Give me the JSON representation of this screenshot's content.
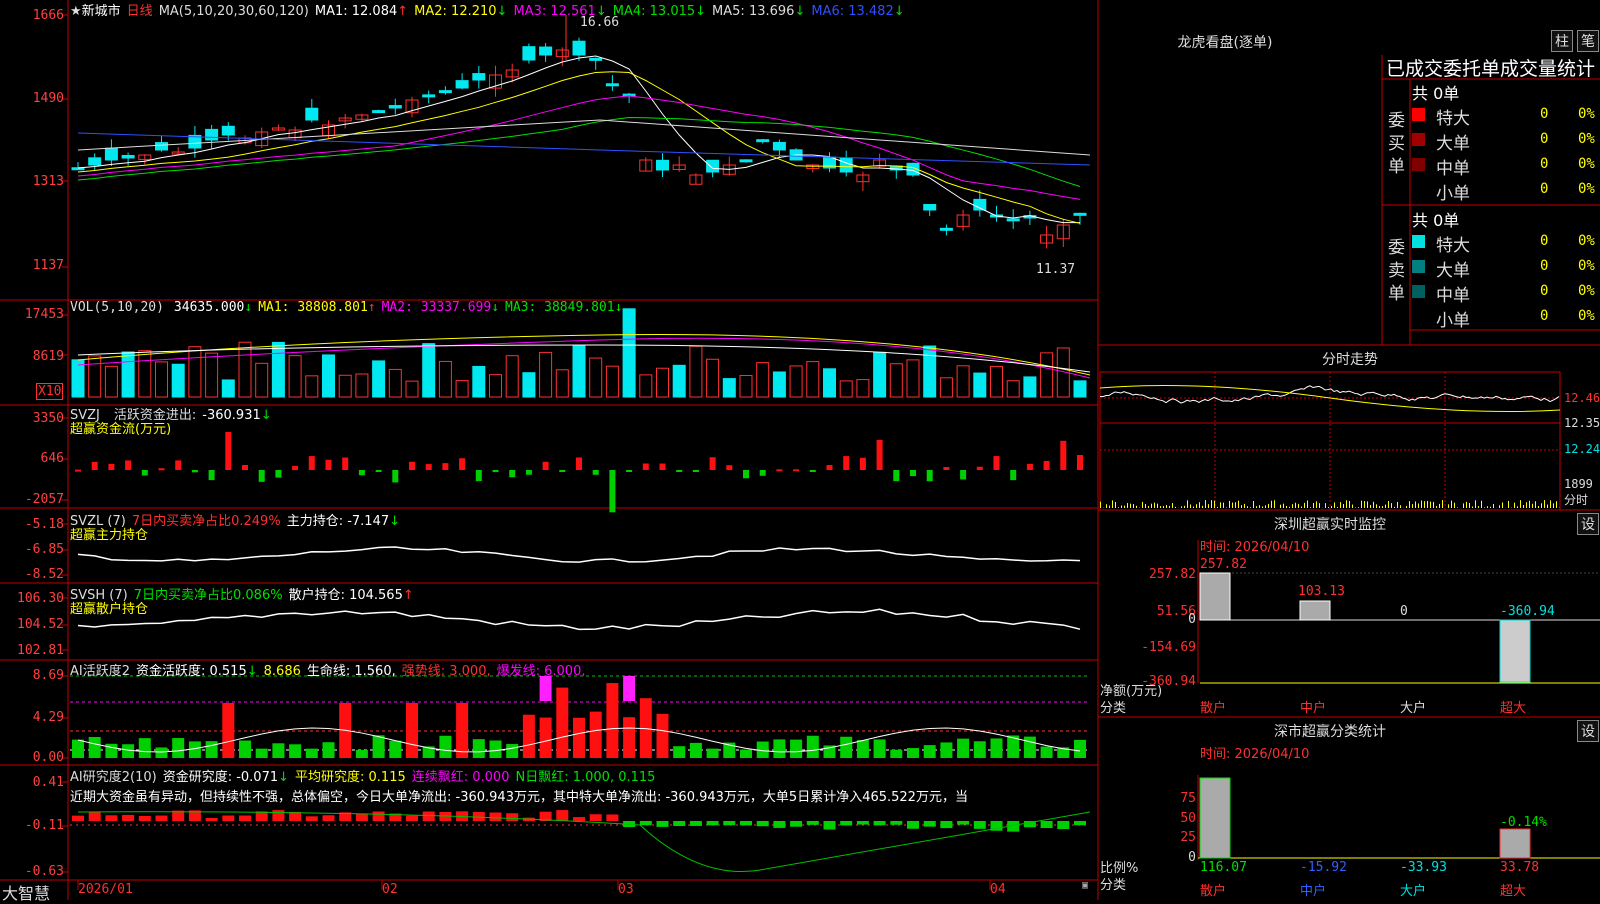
{
  "stock": {
    "star": "★",
    "name": "新城市",
    "period": "日线"
  },
  "main": {
    "ma_header": "MA(5,10,20,30,60,120)",
    "ma1": "MA1: 12.084",
    "ma2": "MA2: 12.210",
    "ma3": "MA3: 12.561",
    "ma4": "MA4: 13.015",
    "ma5": "MA5: 13.696",
    "ma6": "MA6: 13.482",
    "y_labels": [
      "1666",
      "1490",
      "1313",
      "1137"
    ],
    "high_label": "16.66",
    "low_label": "11.37",
    "up_arrow": "↑",
    "down_arrow": "↓"
  },
  "vol": {
    "header": "VOL(5,10,20)",
    "value": "34635.000",
    "ma1": "MA1: 38808.801",
    "ma2": "MA2: 33337.699",
    "ma3": "MA3: 38849.801",
    "y_labels": [
      "17453",
      "8619"
    ],
    "unit": "X10"
  },
  "svzj": {
    "header": "SVZJ",
    "label": "活跃资金进出:",
    "value": "-360.931",
    "subtitle": "超赢资金流(万元)",
    "y_labels": [
      "3350",
      "646",
      "-2057"
    ]
  },
  "svzl": {
    "header": "SVZL (7)",
    "label": "7日内买卖净占比0.249%",
    "hold": "主力持仓: -7.147",
    "subtitle": "超赢主力持仓",
    "y_labels": [
      "-5.18",
      "-6.85",
      "-8.52"
    ]
  },
  "svsh": {
    "header": "SVSH (7)",
    "label": "7日内买卖净占比0.086%",
    "hold": "散户持仓: 104.565",
    "subtitle": "超赢散户持仓",
    "y_labels": [
      "106.30",
      "104.52",
      "102.81"
    ]
  },
  "ai1": {
    "header": "AI活跃度2",
    "label": "资金活跃度: 0.515",
    "val2": "8.686",
    "life": "生命线: 1.560,",
    "strong": "强势线: 3.000,",
    "burst": "爆发线: 6.000,",
    "y_labels": [
      "8.69",
      "4.29",
      "0.00"
    ]
  },
  "ai2": {
    "header": "AI研究度2(10)",
    "label": "资金研究度: -0.071",
    "avg": "平均研究度: 0.115",
    "cont": "连续飘红: 0.000",
    "nday": "N日飘红: 1.000, 0.115",
    "y_labels": [
      "0.41",
      "-0.11",
      "-0.63"
    ],
    "desc": "近期大资金虽有异动，但持续性不强，总体偏空，今日大单净流出: -360.943万元，其中特大单净流出: -360.943万元，大单5日累计净入465.522万元，当"
  },
  "xaxis": {
    "brand": "大智慧",
    "labels": [
      "2026/01",
      "02",
      "03",
      "04"
    ]
  },
  "right": {
    "lhb_title": "龙虎看盘(逐单)",
    "btn_bar": "柱",
    "btn_pen": "笔",
    "table_title": "已成交委托单成交量统计",
    "buy_side": "委买单",
    "sell_side": "委卖单",
    "buy_total": "共 0单",
    "sell_total": "共 0单",
    "rows": [
      {
        "label": "特大",
        "vol": "0",
        "pct": "0%"
      },
      {
        "label": "大单",
        "vol": "0",
        "pct": "0%"
      },
      {
        "label": "中单",
        "vol": "0",
        "pct": "0%"
      },
      {
        "label": "小单",
        "vol": "0",
        "pct": "0%"
      }
    ],
    "fenshi_title": "分时走势",
    "fenshi_y": [
      "12.46",
      "12.35",
      "12.24",
      "1899",
      "分时"
    ],
    "sz_title": "深圳超赢实时监控",
    "settings": "设",
    "time_label": "时间: 2026/04/10",
    "sz_y": [
      "257.82",
      "51.56",
      "0",
      "-154.69",
      "-360.94"
    ],
    "sz_unit": "净额(万元)",
    "sz_cat_label": "分类",
    "sz_values": [
      "257.82",
      "103.13",
      "0",
      "-360.94"
    ],
    "categories": [
      "散户",
      "中户",
      "大户",
      "超大"
    ],
    "cls_title": "深市超赢分类统计",
    "cls_y": [
      "75",
      "50",
      "25",
      "0"
    ],
    "cls_unit": "比例%",
    "cls_cat_label": "分类",
    "cls_values": [
      "116.07",
      "-15.92",
      "-33.93",
      "33.78"
    ],
    "cls_pct": "-0.14%"
  }
}
